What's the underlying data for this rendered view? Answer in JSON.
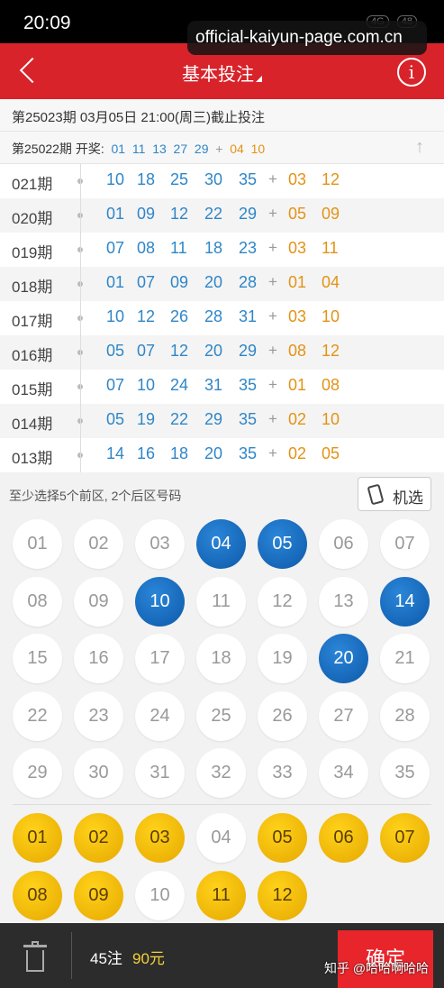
{
  "status_bar": {
    "time": "20:09",
    "icons": [
      "4G",
      "48"
    ]
  },
  "watermark": "official-kaiyun-page.com.cn",
  "header": {
    "title": "基本投注",
    "info_label": "i"
  },
  "issue_info": "第25023期 03月05日 21:00(周三)截止投注",
  "prev_draw": {
    "label": "第25022期 开奖:",
    "front": [
      "01",
      "11",
      "13",
      "27",
      "29"
    ],
    "plus": "+",
    "back": [
      "04",
      "10"
    ]
  },
  "history": [
    {
      "issue": "021期",
      "front": [
        "10",
        "18",
        "25",
        "30",
        "35"
      ],
      "back": [
        "03",
        "12"
      ]
    },
    {
      "issue": "020期",
      "front": [
        "01",
        "09",
        "12",
        "22",
        "29"
      ],
      "back": [
        "05",
        "09"
      ]
    },
    {
      "issue": "019期",
      "front": [
        "07",
        "08",
        "11",
        "18",
        "23"
      ],
      "back": [
        "03",
        "11"
      ]
    },
    {
      "issue": "018期",
      "front": [
        "01",
        "07",
        "09",
        "20",
        "28"
      ],
      "back": [
        "01",
        "04"
      ]
    },
    {
      "issue": "017期",
      "front": [
        "10",
        "12",
        "26",
        "28",
        "31"
      ],
      "back": [
        "03",
        "10"
      ]
    },
    {
      "issue": "016期",
      "front": [
        "05",
        "07",
        "12",
        "20",
        "29"
      ],
      "back": [
        "08",
        "12"
      ]
    },
    {
      "issue": "015期",
      "front": [
        "07",
        "10",
        "24",
        "31",
        "35"
      ],
      "back": [
        "01",
        "08"
      ]
    },
    {
      "issue": "014期",
      "front": [
        "05",
        "19",
        "22",
        "29",
        "35"
      ],
      "back": [
        "02",
        "10"
      ]
    },
    {
      "issue": "013期",
      "front": [
        "14",
        "16",
        "18",
        "20",
        "35"
      ],
      "back": [
        "02",
        "05"
      ]
    }
  ],
  "selection_hint": "至少选择5个前区, 2个后区号码",
  "random_button_label": "机选",
  "front_balls": [
    "01",
    "02",
    "03",
    "04",
    "05",
    "06",
    "07",
    "08",
    "09",
    "10",
    "11",
    "12",
    "13",
    "14",
    "15",
    "16",
    "17",
    "18",
    "19",
    "20",
    "21",
    "22",
    "23",
    "24",
    "25",
    "26",
    "27",
    "28",
    "29",
    "30",
    "31",
    "32",
    "33",
    "34",
    "35"
  ],
  "front_selected": [
    "04",
    "05",
    "10",
    "14",
    "20"
  ],
  "back_balls": [
    "01",
    "02",
    "03",
    "04",
    "05",
    "06",
    "07",
    "08",
    "09",
    "10",
    "11",
    "12"
  ],
  "back_selected": [
    "01",
    "02",
    "03",
    "05",
    "06",
    "07",
    "08",
    "09",
    "11",
    "12"
  ],
  "footer": {
    "bet_count": "45注",
    "amount": "90元",
    "confirm_label": "确定"
  },
  "source_watermark": "知乎 @哈哈啊哈哈",
  "colors": {
    "brand_red": "#d8232a",
    "front_blue": "#0d59aa",
    "back_gold": "#f0b400"
  }
}
